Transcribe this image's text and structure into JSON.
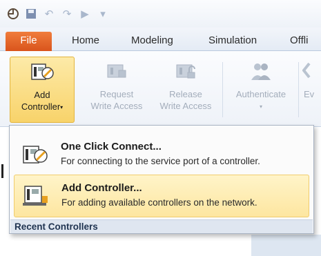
{
  "quick_access": {
    "icons": [
      "app-icon",
      "save-icon",
      "undo-icon",
      "redo-icon",
      "run-icon",
      "customize-icon"
    ]
  },
  "tabs": [
    {
      "label": "File"
    },
    {
      "label": "Home"
    },
    {
      "label": "Modeling"
    },
    {
      "label": "Simulation"
    },
    {
      "label": "Offli"
    }
  ],
  "ribbon": {
    "add_controller": {
      "line1": "Add",
      "line2": "Controller",
      "caret": "▾"
    },
    "request_write": {
      "line1": "Request",
      "line2": "Write Access"
    },
    "release_write": {
      "line1": "Release",
      "line2": "Write Access"
    },
    "authenticate": {
      "line1": "Authenticate",
      "caret": "▾"
    },
    "partial": {
      "line1": "Ev"
    }
  },
  "menu": {
    "items": [
      {
        "title": "One Click Connect...",
        "desc": "For connecting to the service port of a controller."
      },
      {
        "title": "Add Controller...",
        "desc": "For adding available controllers on the network."
      }
    ],
    "section_label": "Recent Controllers"
  },
  "colors": {
    "file_tab": "#e0622a",
    "highlight": "#fde6a0",
    "ribbon_bg": "#eef2f8"
  }
}
